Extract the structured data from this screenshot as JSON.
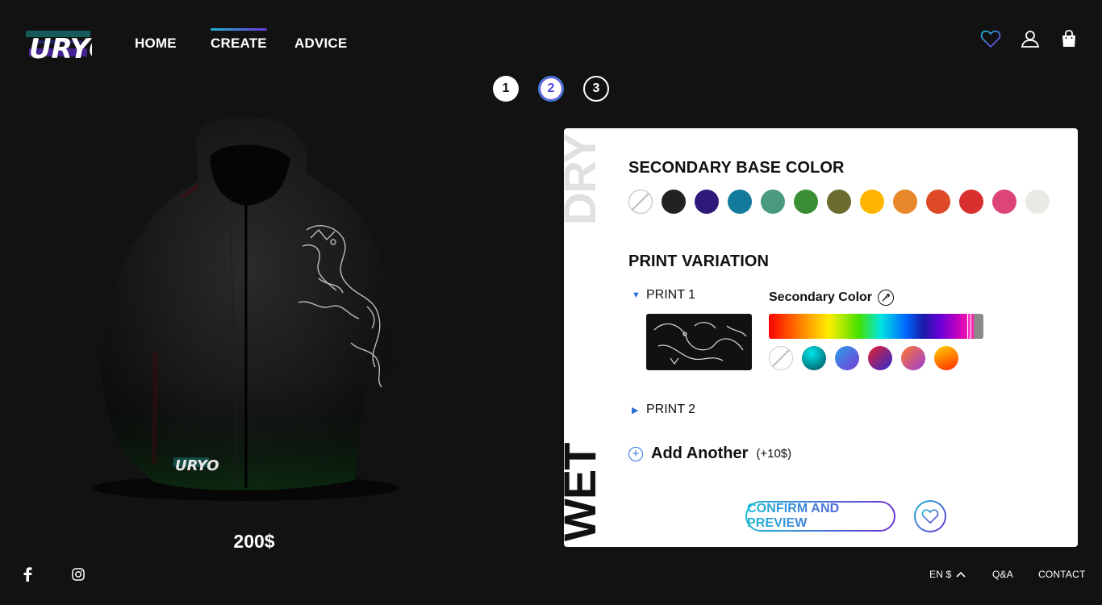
{
  "brand": {
    "logo_text": "URYO"
  },
  "nav": {
    "home": "HOME",
    "create": "CREATE",
    "advice": "ADVICE"
  },
  "steps": [
    "1",
    "2",
    "3"
  ],
  "active_step": 2,
  "product": {
    "price": "200$",
    "logo_text": "URYO"
  },
  "panel": {
    "side_top": "DRY",
    "side_bottom": "WET",
    "base_color_title": "SECONDARY BASE COLOR",
    "base_colors": [
      "none",
      "#222222",
      "#2e1a7a",
      "#137a9c",
      "#4a9a7e",
      "#3a8f35",
      "#6a6b2e",
      "#ffb400",
      "#e8872a",
      "#de4a27",
      "#d8302f",
      "#dd4478",
      "#ebe9e4"
    ],
    "print_variation_title": "PRINT VARIATION",
    "print1_label": "PRINT 1",
    "print2_label": "PRINT 2",
    "secondary_color_label": "Secondary Color",
    "gradient_swatches": [
      "none",
      "radial-gradient(circle at 40% 30%, #00e6e8, #004a5a)",
      "linear-gradient(135deg, #2aa0e8, #7b3ad8)",
      "linear-gradient(135deg, #e8202a, #2b2bd6)",
      "linear-gradient(135deg, #ff7a2a, #9a3ad8)",
      "linear-gradient(160deg, #ffd000, #ff2a00)"
    ],
    "add_another_label": "Add Another",
    "add_another_price": "(+10$)",
    "confirm_label": "CONFIRM AND PREVIEW"
  },
  "footer": {
    "lang": "EN $",
    "qa": "Q&A",
    "contact": "CONTACT"
  },
  "colors": {
    "accent_start": "#1fb7d6",
    "accent_end": "#6b34d9",
    "background": "#121212"
  },
  "icons": [
    "facebook-icon",
    "instagram-icon",
    "heart-icon",
    "user-icon",
    "shopping-bag-icon",
    "eyedropper-icon",
    "chevron-up-icon",
    "plus-circle-icon"
  ]
}
